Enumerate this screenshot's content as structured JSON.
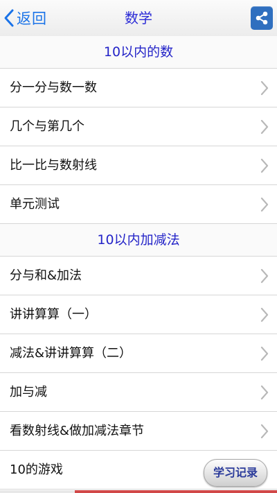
{
  "navbar": {
    "back_label": "返回",
    "title": "数学"
  },
  "sections": [
    {
      "header": "10以内的数",
      "items": [
        "分一分与数一数",
        "几个与第几个",
        "比一比与数射线",
        "单元测试"
      ]
    },
    {
      "header": "10以内加减法",
      "items": [
        "分与和&加法",
        "讲讲算算（一）",
        "减法&讲讲算算（二）",
        "加与减",
        "看数射线&做加减法章节",
        "10的游戏"
      ]
    }
  ],
  "record_button": "学习记录",
  "colors": {
    "accent": "#1a73e8",
    "title": "#2b2bd6",
    "section_header": "#2424c8",
    "share_bg": "#2f6fbf"
  }
}
